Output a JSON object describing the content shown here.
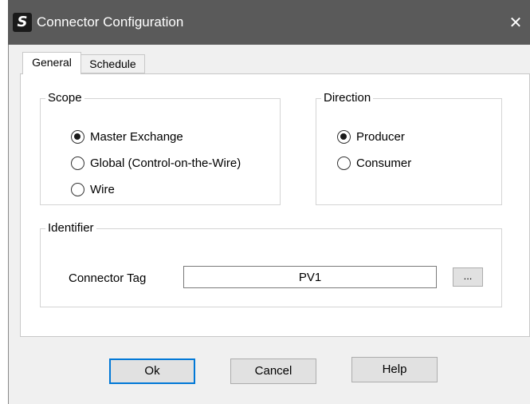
{
  "window": {
    "title": "Connector Configuration",
    "app_icon_glyph": "S",
    "close_glyph": "✕",
    "colors": {
      "titlebar": "#5a5a5a",
      "client": "#f0f0f0",
      "default_button_border": "#0078d7"
    }
  },
  "tabs": [
    {
      "label": "General",
      "selected": true
    },
    {
      "label": "Schedule",
      "selected": false
    }
  ],
  "scope": {
    "legend": "Scope",
    "options": [
      {
        "label": "Master Exchange",
        "checked": true
      },
      {
        "label": "Global (Control-on-the-Wire)",
        "checked": false
      },
      {
        "label": "Wire",
        "checked": false
      }
    ]
  },
  "direction": {
    "legend": "Direction",
    "options": [
      {
        "label": "Producer",
        "checked": true
      },
      {
        "label": "Consumer",
        "checked": false
      }
    ]
  },
  "identifier": {
    "legend": "Identifier",
    "connector_tag_label": "Connector Tag",
    "connector_tag_value": "PV1",
    "browse_label": "..."
  },
  "buttons": {
    "ok": "Ok",
    "cancel": "Cancel",
    "help": "Help"
  }
}
